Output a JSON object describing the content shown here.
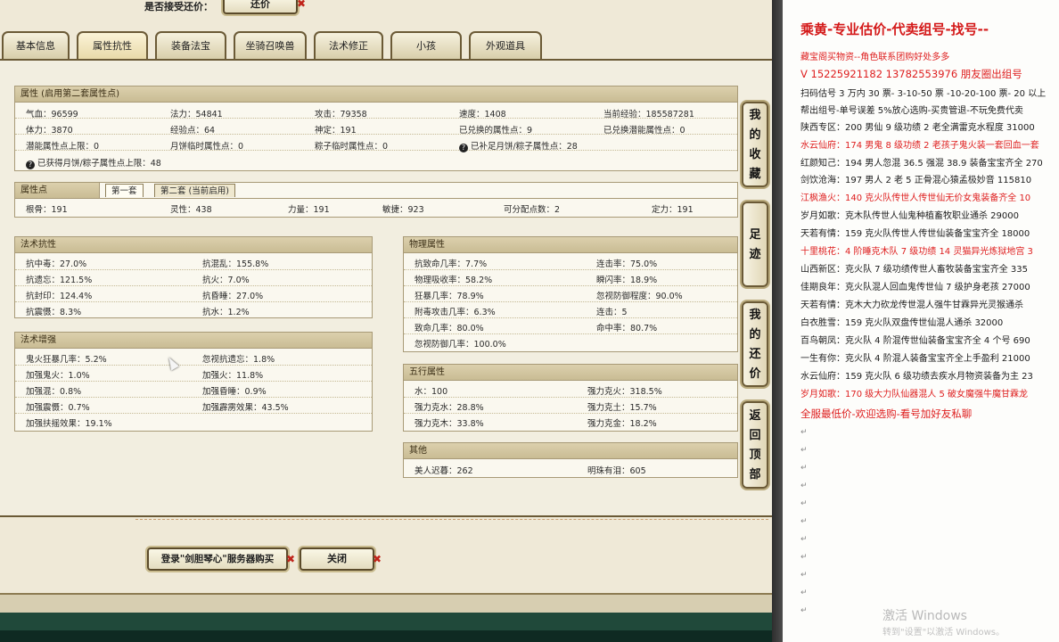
{
  "top": {
    "offer_label": "是否接受还价：",
    "counter_button": "还价"
  },
  "tabs": [
    {
      "label": "基本信息",
      "active": false
    },
    {
      "label": "属性抗性",
      "active": true
    },
    {
      "label": "装备法宝",
      "active": false
    },
    {
      "label": "坐骑召唤兽",
      "active": false
    },
    {
      "label": "法术修正",
      "active": false
    },
    {
      "label": "小孩",
      "active": false
    },
    {
      "label": "外观道具",
      "active": false
    }
  ],
  "attributes": {
    "title": "属性 (启用第二套属性点)",
    "rows": [
      [
        "气血：96599",
        "法力：54841",
        "攻击：79358",
        "速度：1408",
        "当前经验：185587281"
      ],
      [
        "体力：3870",
        "经验点：64",
        "神定：191",
        "已兑换的属性点：9",
        "已兑换潜能属性点：0"
      ],
      [
        "潜能属性点上限：0",
        "月饼临时属性点：0",
        "粽子临时属性点：0",
        "已补足月饼/粽子属性点：28",
        ""
      ]
    ],
    "footer": "已获得月饼/粽子属性点上限：48"
  },
  "points": {
    "title": "属性点",
    "subtabs": [
      "第一套",
      "第二套 (当前启用)"
    ],
    "row": [
      "根骨：191",
      "灵性：438",
      "力量：191",
      "敏捷：923",
      "可分配点数：2",
      "定力：191"
    ]
  },
  "resist": {
    "title": "法术抗性",
    "rows": [
      [
        "抗中毒：27.0%",
        "抗混乱：155.8%"
      ],
      [
        "抗遗忘：121.5%",
        "抗火：7.0%"
      ],
      [
        "抗封印：124.4%",
        "抗昏睡：27.0%"
      ],
      [
        "抗震慑：8.3%",
        "抗水：1.2%"
      ]
    ]
  },
  "enhance": {
    "title": "法术增强",
    "rows": [
      [
        "鬼火狂暴几率：5.2%",
        "忽视抗遗忘：1.8%"
      ],
      [
        "加强鬼火：1.0%",
        "加强火：11.8%"
      ],
      [
        "加强混：0.8%",
        "加强昏睡：0.9%"
      ],
      [
        "加强震慑：0.7%",
        "加强霹雳效果：43.5%"
      ],
      [
        "加强扶摇效果：19.1%",
        ""
      ]
    ]
  },
  "physical": {
    "title": "物理属性",
    "rows": [
      [
        "抗致命几率：7.7%",
        "连击率：75.0%"
      ],
      [
        "物理吸收率：58.2%",
        "瞬闪率：18.9%"
      ],
      [
        "狂暴几率：78.9%",
        "忽视防御程度：90.0%"
      ],
      [
        "附毒攻击几率：6.3%",
        "连击：5"
      ],
      [
        "致命几率：80.0%",
        "命中率：80.7%"
      ],
      [
        "忽视防御几率：100.0%",
        ""
      ]
    ]
  },
  "elements": {
    "title": "五行属性",
    "rows": [
      [
        "水：100",
        "强力克火：318.5%"
      ],
      [
        "强力克水：28.8%",
        "强力克土：15.7%"
      ],
      [
        "强力克木：33.8%",
        "强力克金：18.2%"
      ]
    ]
  },
  "other": {
    "title": "其他",
    "rows": [
      [
        "美人迟暮：262",
        "明珠有泪：605"
      ]
    ]
  },
  "side": {
    "favorites": [
      "我",
      "的",
      "收",
      "藏"
    ],
    "footprints": [
      "足",
      "迹"
    ],
    "my_offers": [
      "我",
      "的",
      "还",
      "价"
    ],
    "back_top": [
      "返",
      "回",
      "顶",
      "部"
    ]
  },
  "bottom": {
    "login_button": "登录\"剑胆琴心\"服务器购买",
    "close_button": "关闭"
  },
  "doc": {
    "title": "乘黄-专业估价-代卖组号-找号--",
    "lines": [
      {
        "text": "藏宝阁买物资--角色联系团购好处多多",
        "cls": "red"
      },
      {
        "text": "V 15225921182   13782553976 朋友圈出组号",
        "cls": "red big"
      },
      {
        "text": "扫码估号 3 万内 30 票- 3-10-50 票  -10-20-100 票- 20 以上",
        "cls": ""
      },
      {
        "text": "帮出组号-单号误差 5%放心选购-买贵管退-不玩免费代卖",
        "cls": ""
      },
      {
        "text": "陕西专区：200 男仙 9 级功绩 2 老全满雷克水程度 31000",
        "cls": ""
      },
      {
        "text": "水云仙府：174 男鬼 8 级功绩 2 老孩子鬼火装一套回血一套",
        "cls": "red"
      },
      {
        "text": "红颜知己：194 男人忽混 36.5 强混 38.9 装备宝宝齐全 270",
        "cls": ""
      },
      {
        "text": "剑饮沧海：197 男人 2 老 5 正骨混心猿孟极妙音 115810",
        "cls": ""
      },
      {
        "text": "江枫渔火：140 克火队传世人传世仙无价女鬼装备齐全 10",
        "cls": "red"
      },
      {
        "text": "岁月如歌：克木队传世人仙鬼种植畜牧职业通杀 29000",
        "cls": ""
      },
      {
        "text": "天若有情：159 克火队传世人传世仙装备宝宝齐全 18000",
        "cls": ""
      },
      {
        "text": "十里桃花：4 阶睡克木队 7 级功绩 14 灵猫异光炼狱地宫 3",
        "cls": "red"
      },
      {
        "text": "山西新区：克火队 7 级功绩传世人畜牧装备宝宝齐全 335",
        "cls": ""
      },
      {
        "text": "佳期良年：克火队混人回血鬼传世仙 7 级护身老孩 27000",
        "cls": ""
      },
      {
        "text": "天若有情：克木大力砍龙传世混人强牛甘霖异光灵猴通杀",
        "cls": ""
      },
      {
        "text": "白衣胜雪：159 克火队双盘传世仙混人通杀 32000",
        "cls": ""
      },
      {
        "text": "百鸟朝凤：克火队 4 阶混传世仙装备宝宝齐全 4 个号 690",
        "cls": ""
      },
      {
        "text": "一生有你：克火队 4 阶混人装备宝宝齐全上手盈利 21000",
        "cls": ""
      },
      {
        "text": "水云仙府：159 克火队 6 级功绩去疾水月物资装备为主 23",
        "cls": ""
      },
      {
        "text": "岁月如歌：170 级大力队仙器混人 5 破女魔强牛魔甘霖龙",
        "cls": "red"
      },
      {
        "text": "全服最低价-欢迎选购-看号加好友私聊",
        "cls": "red big"
      }
    ],
    "watermark_title": "激活 Windows",
    "watermark_sub": "转到\"设置\"以激活 Windows。"
  }
}
